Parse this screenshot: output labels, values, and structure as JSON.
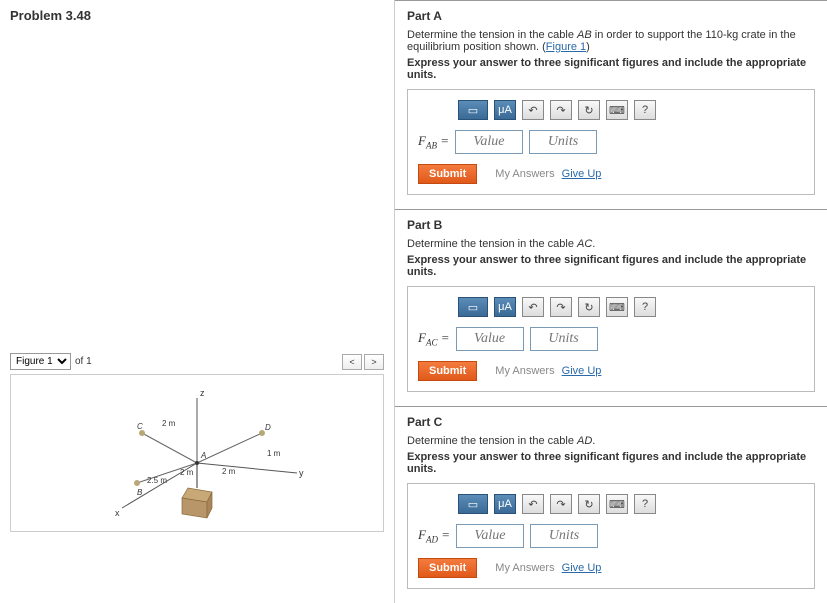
{
  "problem_title": "Problem 3.48",
  "figure": {
    "select_label": "Figure 1",
    "of_text": "of 1",
    "prev": "<",
    "next": ">"
  },
  "diagram": {
    "dim_2m": "2 m",
    "dim_25m": "2.5 m",
    "dim_1m": "1 m",
    "A": "A",
    "B": "B",
    "C": "C",
    "D": "D",
    "x": "x",
    "y": "y",
    "z": "z"
  },
  "parts": [
    {
      "title": "Part A",
      "desc_pre": "Determine the tension in the cable ",
      "cable": "AB",
      "desc_post": " in order to support the 110-kg crate in the equilibrium position shown. (",
      "fig_link": "Figure 1",
      "desc_end": ")",
      "instruct": "Express your answer to three significant figures and include the appropriate units.",
      "var_pre": "F",
      "var_sub": "AB",
      "value_ph": "Value",
      "units_ph": "Units",
      "submit": "Submit",
      "my_ans": "My Answers",
      "giveup": "Give Up"
    },
    {
      "title": "Part B",
      "desc_pre": "Determine the tension in the cable ",
      "cable": "AC",
      "desc_post": ".",
      "fig_link": "",
      "desc_end": "",
      "instruct": "Express your answer to three significant figures and include the appropriate units.",
      "var_pre": "F",
      "var_sub": "AC",
      "value_ph": "Value",
      "units_ph": "Units",
      "submit": "Submit",
      "my_ans": "My Answers",
      "giveup": "Give Up"
    },
    {
      "title": "Part C",
      "desc_pre": "Determine the tension in the cable ",
      "cable": "AD",
      "desc_post": ".",
      "fig_link": "",
      "desc_end": "",
      "instruct": "Express your answer to three significant figures and include the appropriate units.",
      "var_pre": "F",
      "var_sub": "AD",
      "value_ph": "Value",
      "units_ph": "Units",
      "submit": "Submit",
      "my_ans": "My Answers",
      "giveup": "Give Up"
    }
  ],
  "toolbar_help": "?"
}
